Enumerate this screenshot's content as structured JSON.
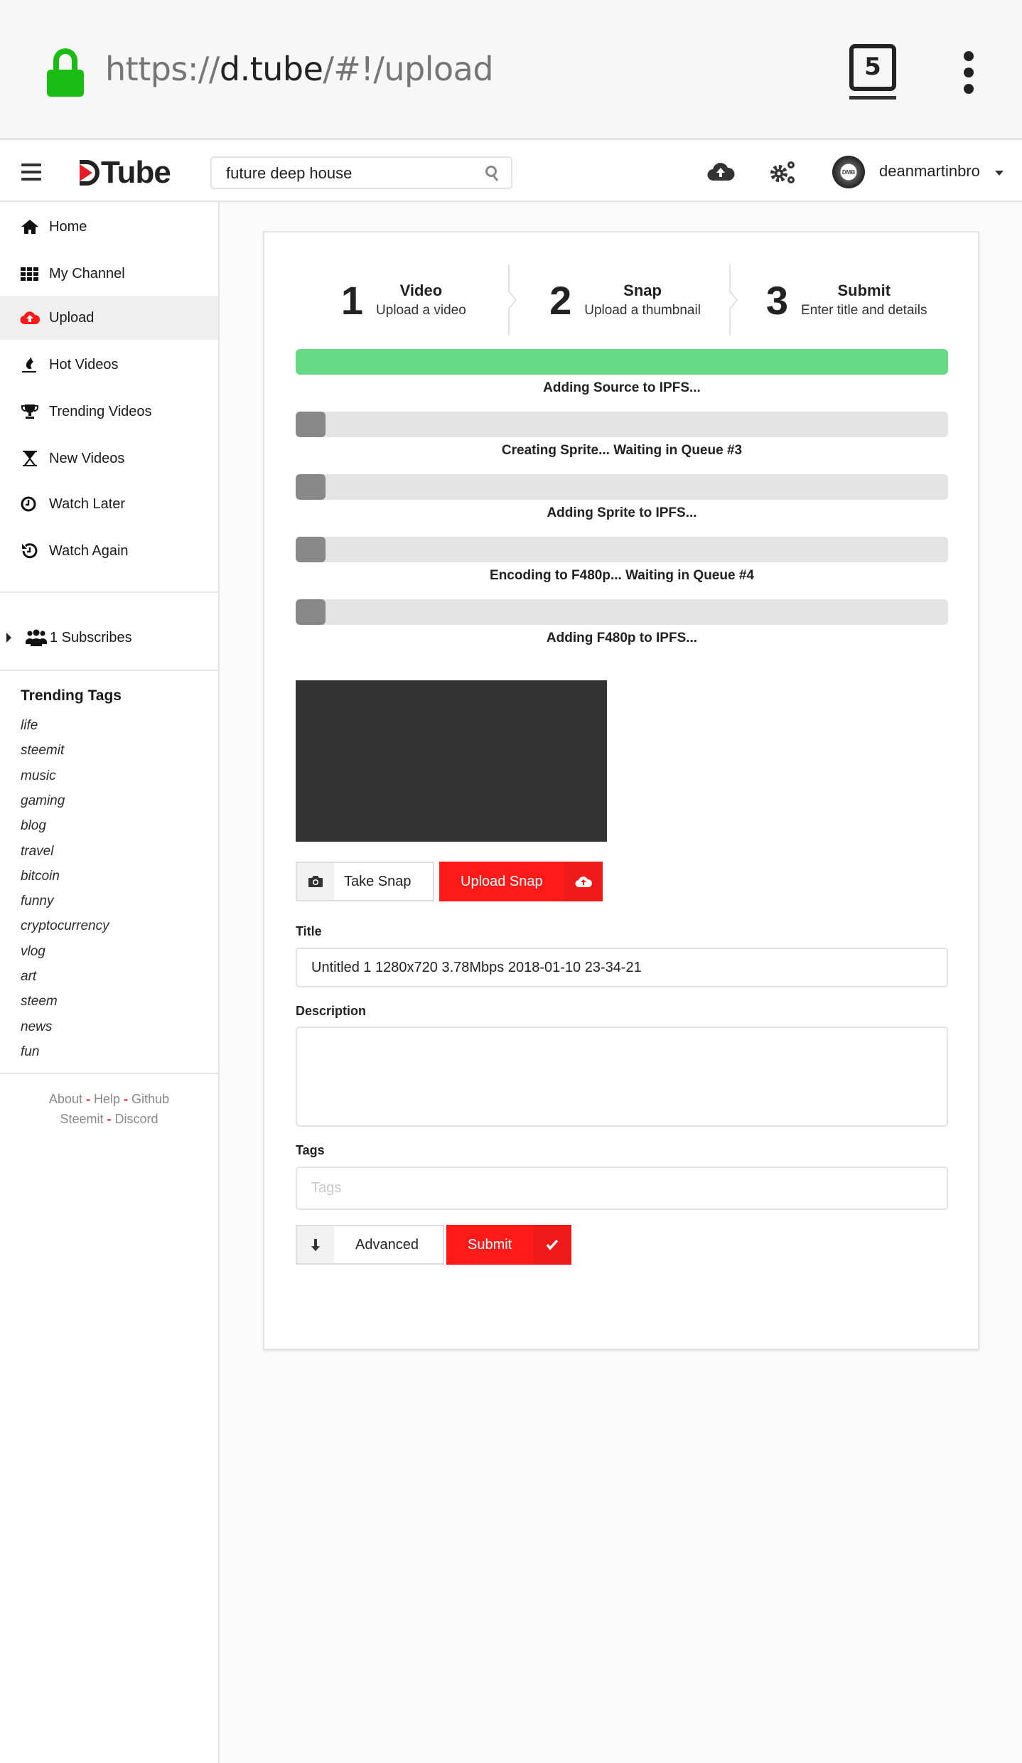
{
  "browser": {
    "url_scheme": "https://",
    "url_host": "d.tube",
    "url_path": "/#!/upload",
    "tab_count": "5",
    "lock_color": "#1bbd14"
  },
  "header": {
    "logo_text": "Tube",
    "search_value": "future deep house",
    "username": "deanmartinbro",
    "avatar_initials": "DMB",
    "icons": [
      "menu-icon",
      "search-icon",
      "upload-cloud-icon",
      "settings-gears-icon",
      "caret-down-icon"
    ]
  },
  "sidebar": {
    "items": [
      {
        "label": "Home",
        "icon": "home-icon",
        "active": false
      },
      {
        "label": "My Channel",
        "icon": "grid-icon",
        "active": false
      },
      {
        "label": "Upload",
        "icon": "upload-cloud-icon",
        "active": true
      },
      {
        "label": "Hot Videos",
        "icon": "fire-icon",
        "active": false
      },
      {
        "label": "Trending Videos",
        "icon": "trophy-icon",
        "active": false
      },
      {
        "label": "New Videos",
        "icon": "hourglass-icon",
        "active": false
      },
      {
        "label": "Watch Later",
        "icon": "clock-icon",
        "active": false
      },
      {
        "label": "Watch Again",
        "icon": "history-icon",
        "active": false
      }
    ],
    "subscribes_label": "1 Subscribes",
    "trending_tags_title": "Trending Tags",
    "tags": [
      "life",
      "steemit",
      "music",
      "gaming",
      "blog",
      "travel",
      "bitcoin",
      "funny",
      "cryptocurrency",
      "vlog",
      "art",
      "steem",
      "news",
      "fun"
    ],
    "footer_links": [
      "About",
      "Help",
      "Github",
      "Steemit",
      "Discord"
    ],
    "footer_separator": "-"
  },
  "steps": [
    {
      "number": "1",
      "title": "Video",
      "desc": "Upload a video"
    },
    {
      "number": "2",
      "title": "Snap",
      "desc": "Upload a thumbnail"
    },
    {
      "number": "3",
      "title": "Submit",
      "desc": "Enter title and details"
    }
  ],
  "progress": [
    {
      "label": "Adding Source to IPFS...",
      "percent": 100,
      "color": "#66d985"
    },
    {
      "label": "Creating Sprite... Waiting in Queue #3",
      "percent": 0,
      "color": "#888888"
    },
    {
      "label": "Adding Sprite to IPFS...",
      "percent": 0,
      "color": "#888888"
    },
    {
      "label": "Encoding to F480p... Waiting in Queue #4",
      "percent": 0,
      "color": "#888888"
    },
    {
      "label": "Adding F480p to IPFS...",
      "percent": 0,
      "color": "#888888"
    }
  ],
  "snap": {
    "take_snap_label": "Take Snap",
    "upload_snap_label": "Upload Snap"
  },
  "form": {
    "title_label": "Title",
    "title_value": "Untitled 1 1280x720 3.78Mbps 2018-01-10 23-34-21",
    "description_label": "Description",
    "description_value": "",
    "tags_label": "Tags",
    "tags_placeholder": "Tags",
    "advanced_label": "Advanced",
    "submit_label": "Submit"
  },
  "colors": {
    "accent_red": "#ff1a1a",
    "progress_green": "#66d985"
  }
}
